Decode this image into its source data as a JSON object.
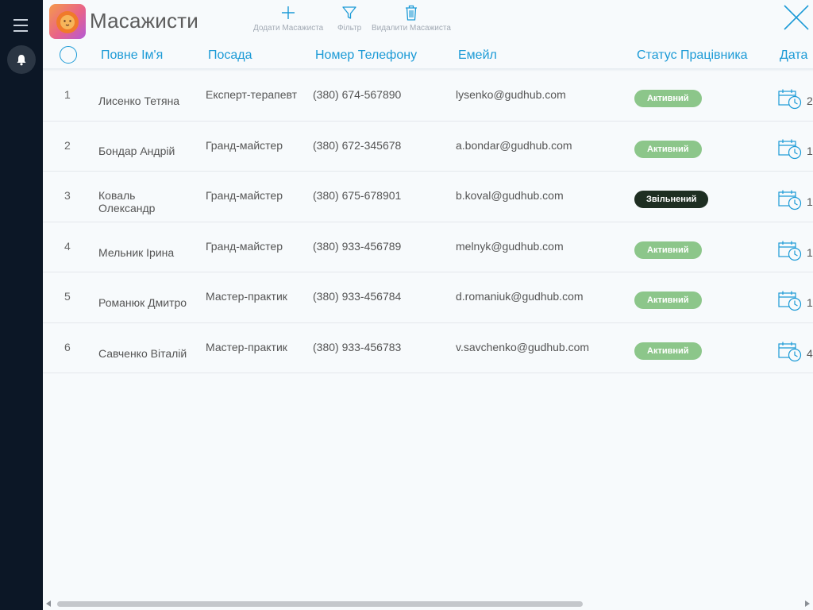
{
  "app": {
    "title": "Масажисти",
    "logo_icon": "lion-logo-icon"
  },
  "toolbar": {
    "add_label": "Додати Масажиста",
    "filter_label": "Фільтр",
    "delete_label": "Видалити Масажиста"
  },
  "columns": {
    "name": "Повне Ім'я",
    "position": "Посада",
    "phone": "Номер Телефону",
    "email": "Емейл",
    "status": "Статус Працівника",
    "date": "Дата"
  },
  "rows": [
    {
      "num": "1",
      "name": "Лисенко Тетяна",
      "position": "Експерт-терапевт",
      "phone": "(380) 674-567890",
      "email": "lysenko@gudhub.com",
      "status": "Активний",
      "status_type": "active",
      "date_fragment": "2"
    },
    {
      "num": "2",
      "name": "Бондар Андрій",
      "position": "Гранд-майстер",
      "phone": "(380) 672-345678",
      "email": "a.bondar@gudhub.com",
      "status": "Активний",
      "status_type": "active",
      "date_fragment": "1"
    },
    {
      "num": "3",
      "name": "Коваль Олександр",
      "position": "Гранд-майстер",
      "phone": "(380) 675-678901",
      "email": "b.koval@gudhub.com",
      "status": "Звільнений",
      "status_type": "fired",
      "date_fragment": "1"
    },
    {
      "num": "4",
      "name": "Мельник Ірина",
      "position": "Гранд-майстер",
      "phone": "(380) 933-456789",
      "email": "melnyk@gudhub.com",
      "status": "Активний",
      "status_type": "active",
      "date_fragment": "1"
    },
    {
      "num": "5",
      "name": "Романюк Дмитро",
      "position": "Мастер-практик",
      "phone": "(380) 933-456784",
      "email": "d.romaniuk@gudhub.com",
      "status": "Активний",
      "status_type": "active",
      "date_fragment": "1"
    },
    {
      "num": "6",
      "name": "Савченко Віталій",
      "position": "Мастер-практик",
      "phone": "(380) 933-456783",
      "email": "v.savchenko@gudhub.com",
      "status": "Активний",
      "status_type": "active",
      "date_fragment": "4"
    }
  ],
  "colors": {
    "sidebar": "#0c1726",
    "accent": "#1b9ad6",
    "status_active": "#8cc68a",
    "status_fired": "#1e2e22"
  }
}
